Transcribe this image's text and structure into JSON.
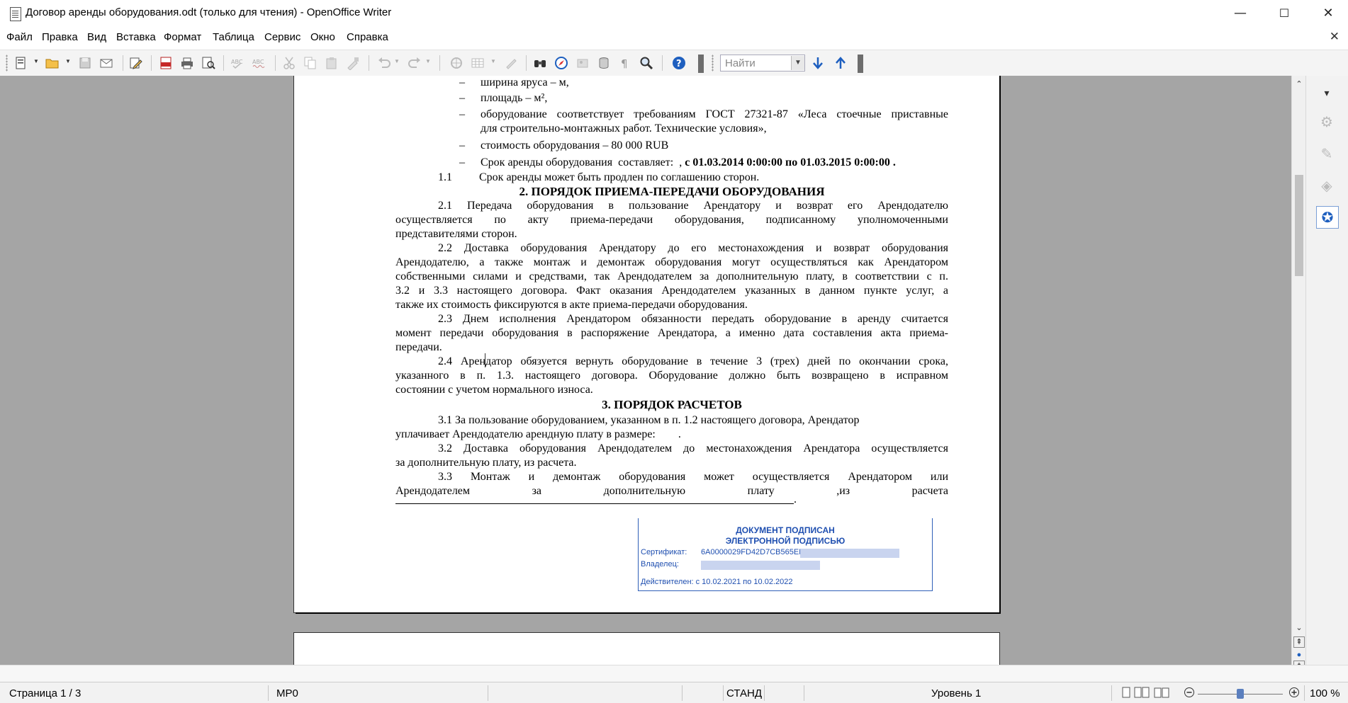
{
  "window": {
    "title": "Договор аренды оборудования.odt (только для чтения) - OpenOffice Writer",
    "controls": {
      "minimize": "—",
      "maximize": "☐",
      "close": "✕"
    }
  },
  "menu": {
    "items": [
      "Файл",
      "Правка",
      "Вид",
      "Вставка",
      "Формат",
      "Таблица",
      "Сервис",
      "Окно",
      "Справка"
    ],
    "close_doc": "✕"
  },
  "toolbar": {
    "find_placeholder": "Найти",
    "icons": [
      "new-document-icon",
      "open-folder-icon",
      "save-icon",
      "email-icon",
      "edit-file-icon",
      "export-pdf-icon",
      "print-icon",
      "print-preview-icon",
      "spellcheck-icon",
      "autospellcheck-icon",
      "cut-icon",
      "copy-icon",
      "paste-icon",
      "clone-format-icon",
      "undo-icon",
      "redo-icon",
      "hyperlink-icon",
      "table-icon",
      "draw-icon",
      "find-replace-icon",
      "navigator-icon",
      "gallery-icon",
      "data-sources-icon",
      "nonprinting-chars-icon",
      "zoom-icon",
      "help-icon",
      "find-next-icon",
      "find-prev-icon"
    ],
    "accent": "#1e5fbf"
  },
  "document": {
    "bullets": [
      "ширина яруса –  м,",
      "площадь –  м²,",
      "оборудование соответствует требованиям ГОСТ 27321-87 «Леса стоечные приставные",
      "для строительно-монтажных работ. Технические условия»,",
      "стоимость оборудования – 80 000 RUB"
    ],
    "term_label": "Срок аренды оборудования  составляет:  ,",
    "term_value": " с 01.03.2014 0:00:00 по 01.03.2015 0:00:00 .",
    "p1_1_num": "1.1",
    "p1_1_text": "Срок аренды может быть продлен по соглашению сторон.",
    "heading2": "2. ПОРЯДОК ПРИЕМА-ПЕРЕДАЧИ ОБОРУДОВАНИЯ",
    "p2_1": [
      "2.1    Передача оборудования в пользование Арендатору и возврат его Арендодателю",
      "осуществляется по акту приема-передачи оборудования, подписанному уполномоченными",
      "представителями сторон."
    ],
    "p2_2": [
      "2.2    Доставка оборудования Арендатору  до его местонахождения  и возврат оборудования",
      "Арендодателю, а также  монтаж и демонтаж оборудования могут осуществляться как Арендатором",
      "собственными силами и средствами, так Арендодателем за дополнительную плату, в соответствии с п.",
      "3.2 и 3.3 настоящего договора. Факт оказания Арендодателем указанных в данном пункте услуг, а",
      "также их стоимость фиксируются в акте приема-передачи оборудования."
    ],
    "p2_3": [
      "2.3    Днем исполнения Арендатором обязанности передать оборудование в аренду считается",
      "момент передачи оборудования в распоряжение Арендатора, а именно дата составления акта приема-",
      "передачи."
    ],
    "p2_4": [
      "2.4    Арендатор обязуется вернуть оборудование в течение 3 (трех) дней по окончании срока,",
      "указанного в п. 1.3. настоящего договора. Оборудование должно быть возвращено в исправном",
      "состоянии с учетом нормального износа."
    ],
    "heading3": "3. ПОРЯДОК РАСЧЕТОВ",
    "p3_1": [
      "3.1    За пользование оборудованием, указанном в п. 1.2 настоящего договора, Арендатор",
      "уплачивает Арендодателю арендную плату в размере:        ."
    ],
    "p3_2": [
      "3.2    Доставка оборудования Арендодателем до местонахождения Арендатора осуществляется",
      "за дополнительную плату, из расчета."
    ],
    "p3_3": [
      "3.3    Монтаж и демонтаж оборудования может осуществляется Арендатором или",
      "Арендодателем за дополнительную плату ,из расчета"
    ],
    "underline_end": "."
  },
  "stamp": {
    "line1": "ДОКУМЕНТ ПОДПИСАН",
    "line2": "ЭЛЕКТРОННОЙ ПОДПИСЬЮ",
    "cert_label": "Сертификат:",
    "cert_value": "6A0000029FD42D7CB565ED",
    "owner_label": "Владелец:",
    "valid": "Действителен: с 10.02.2021 по 10.02.2022",
    "color": "#1f4fb0"
  },
  "status": {
    "page": "Страница  1 / 3",
    "style": "MP0",
    "mode": "СТАНД",
    "level": "Уровень  1",
    "zoom": "100 %",
    "zoom_level_percent": 100
  }
}
